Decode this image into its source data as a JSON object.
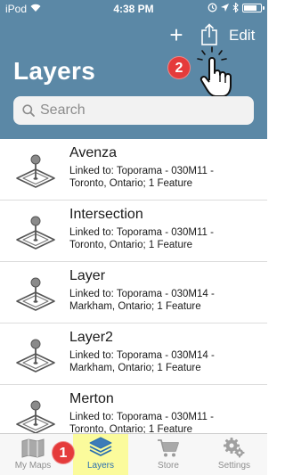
{
  "status_bar": {
    "carrier": "iPod",
    "time": "4:38 PM",
    "battery_level": 0.85
  },
  "nav": {
    "add_icon": "plus-icon",
    "share_icon": "share-icon",
    "edit_label": "Edit",
    "title": "Layers"
  },
  "annotations": {
    "badge_share": "2",
    "badge_layers_tab": "1"
  },
  "search": {
    "placeholder": "Search"
  },
  "layers": [
    {
      "name": "Avenza",
      "detail": "Linked to: Toporama - 030M11 - Toronto, Ontario; 1 Feature"
    },
    {
      "name": "Intersection",
      "detail": "Linked to: Toporama - 030M11 - Toronto, Ontario; 1 Feature"
    },
    {
      "name": "Layer",
      "detail": "Linked to: Toporama - 030M14 - Markham, Ontario; 1 Feature"
    },
    {
      "name": "Layer2",
      "detail": "Linked to: Toporama - 030M14 - Markham, Ontario; 1 Feature"
    },
    {
      "name": "Merton",
      "detail": "Linked to: Toporama - 030M11 - Toronto, Ontario; 1 Feature"
    }
  ],
  "tabs": [
    {
      "label": "My Maps",
      "icon": "map-icon"
    },
    {
      "label": "Layers",
      "icon": "layers-icon"
    },
    {
      "label": "Store",
      "icon": "cart-icon"
    },
    {
      "label": "Settings",
      "icon": "gear-icon"
    }
  ],
  "colors": {
    "header": "#5b88a6",
    "badge": "#e53b3b",
    "highlight": "#fbfb9c",
    "active_tab": "#2a6fb0"
  }
}
